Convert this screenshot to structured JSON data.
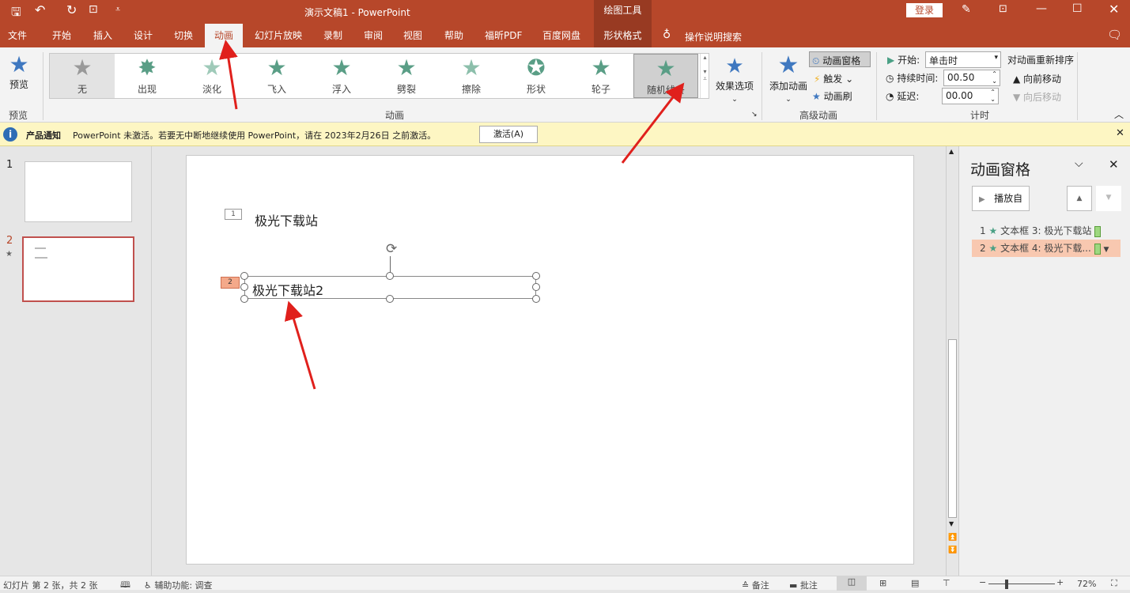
{
  "title_bar": {
    "title": "演示文稿1  -  PowerPoint",
    "context_tab_group": "绘图工具",
    "login": "登录"
  },
  "tabs": [
    {
      "label": "文件"
    },
    {
      "label": "开始"
    },
    {
      "label": "插入"
    },
    {
      "label": "设计"
    },
    {
      "label": "切换"
    },
    {
      "label": "动画",
      "active": true
    },
    {
      "label": "幻灯片放映"
    },
    {
      "label": "录制"
    },
    {
      "label": "审阅"
    },
    {
      "label": "视图"
    },
    {
      "label": "帮助"
    },
    {
      "label": "福昕PDF"
    },
    {
      "label": "百度网盘"
    },
    {
      "label": "形状格式"
    }
  ],
  "tell_me": "操作说明搜索",
  "ribbon": {
    "preview": {
      "label": "预览",
      "group": "预览"
    },
    "animations": [
      {
        "label": "无"
      },
      {
        "label": "出现"
      },
      {
        "label": "淡化"
      },
      {
        "label": "飞入"
      },
      {
        "label": "浮入"
      },
      {
        "label": "劈裂"
      },
      {
        "label": "擦除"
      },
      {
        "label": "形状"
      },
      {
        "label": "轮子"
      },
      {
        "label": "随机线条",
        "selected": true
      }
    ],
    "effect_options": "效果选项",
    "animation_group": "动画",
    "add_animation": "添加动画",
    "animation_pane": "动画窗格",
    "trigger": "触发",
    "painter": "动画刷",
    "advanced_group": "高级动画",
    "start_label": "开始:",
    "start_value": "单击时",
    "duration_label": "持续时间:",
    "duration_value": "00.50",
    "delay_label": "延迟:",
    "delay_value": "00.00",
    "timing_group": "计时",
    "reorder": "对动画重新排序",
    "move_earlier": "向前移动",
    "move_later": "向后移动"
  },
  "notification": {
    "title": "产品通知",
    "message": "PowerPoint 未激活。若要无中断地继续使用 PowerPoint，请在 2023年2月26日 之前激活。",
    "button": "激活(A)"
  },
  "slides": [
    {
      "number": "1"
    },
    {
      "number": "2",
      "has_animation": true,
      "selected": true
    }
  ],
  "slide": {
    "tag1": "1",
    "text1": "极光下载站",
    "tag2": "2",
    "text2": "极光下载站2"
  },
  "pane": {
    "title": "动画窗格",
    "play": "播放自",
    "items": [
      {
        "num": "1",
        "label": "文本框 3: 极光下载站"
      },
      {
        "num": "2",
        "label": "文本框 4: 极光下载...",
        "selected": true
      }
    ]
  },
  "status": {
    "slide_info": "幻灯片 第 2 张，共 2 张",
    "accessibility": "辅助功能: 调查",
    "notes": "备注",
    "comments": "批注",
    "zoom": "72%"
  },
  "colors": {
    "brand": "#b7472a",
    "anim_star": "#5a9e86",
    "selected_item": "#f8c8b0",
    "arrow": "#e0201c"
  }
}
